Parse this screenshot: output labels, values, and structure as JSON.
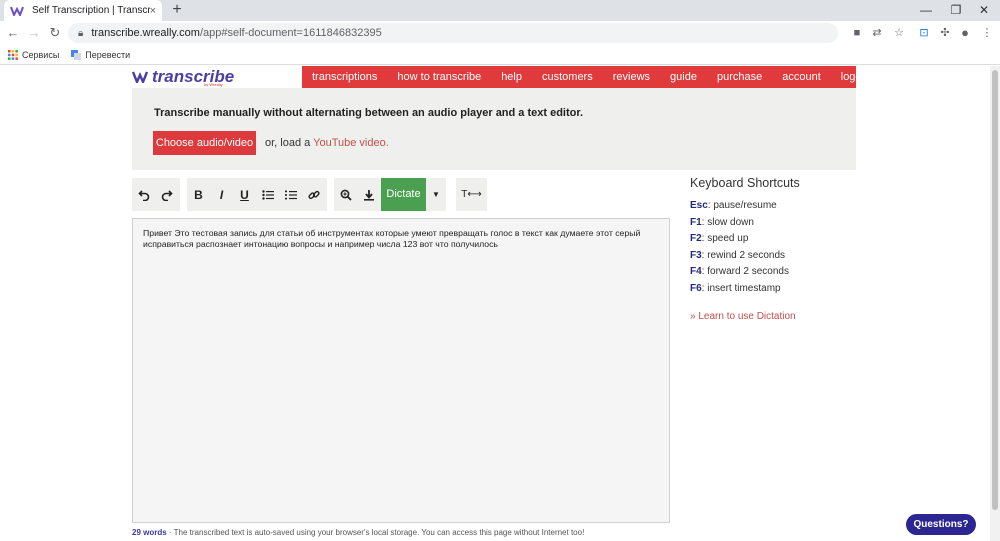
{
  "browser": {
    "tab_title": "Self Transcription | Transcribe",
    "tab_close": "×",
    "new_tab": "+",
    "url_host": "transcribe.wreally.com",
    "url_path": "/app#self-document=1611846832395",
    "bookmarks": [
      {
        "label": "Сервисы",
        "icon": "apps-grid-icon"
      },
      {
        "label": "Перевести",
        "icon": "translate-icon"
      }
    ]
  },
  "logo": {
    "text": "transcribe",
    "sub": "by Wreally"
  },
  "topnav": [
    "transcriptions",
    "how to transcribe",
    "help",
    "customers",
    "reviews",
    "guide",
    "purchase",
    "account",
    "logout"
  ],
  "intro": {
    "title": "Transcribe manually without alternating between an audio player and a text editor.",
    "choose_button": "Choose audio/video",
    "or_text": "or, load a ",
    "youtube_link": "YouTube video."
  },
  "toolbar": {
    "dictate_label": "Dictate",
    "icons": [
      "undo-icon",
      "redo-icon",
      "bold-icon",
      "italic-icon",
      "underline-icon",
      "bullet-list-icon",
      "numbered-list-icon",
      "link-icon",
      "zoom-icon",
      "download-icon",
      "text-width-icon"
    ]
  },
  "editor": {
    "text": "Привет Это тестовая запись для статьи об инструментах которые умеют превращать голос в текст как думаете этот серый исправиться распознает интонацию вопросы и например числа 123 вот что получилось"
  },
  "status": {
    "word_count": "29 words",
    "message": " · The transcribed text is auto-saved using your browser's local storage. You can access this page without Internet too!"
  },
  "shortcuts": {
    "title": "Keyboard Shortcuts",
    "items": [
      {
        "key": "Esc",
        "desc": ": pause/resume"
      },
      {
        "key": "F1",
        "desc": ": slow down"
      },
      {
        "key": "F2",
        "desc": ": speed up"
      },
      {
        "key": "F3",
        "desc": ": rewind 2 seconds"
      },
      {
        "key": "F4",
        "desc": ": forward 2 seconds"
      },
      {
        "key": "F6",
        "desc": ": insert timestamp"
      }
    ],
    "learn_link": "» Learn to use Dictation"
  },
  "questions_button": "Questions?",
  "colors": {
    "brand_red": "#e03a3c",
    "dictate_green": "#4aa050",
    "logo_purple": "#4b3fa3",
    "questions_blue": "#2b2690"
  }
}
